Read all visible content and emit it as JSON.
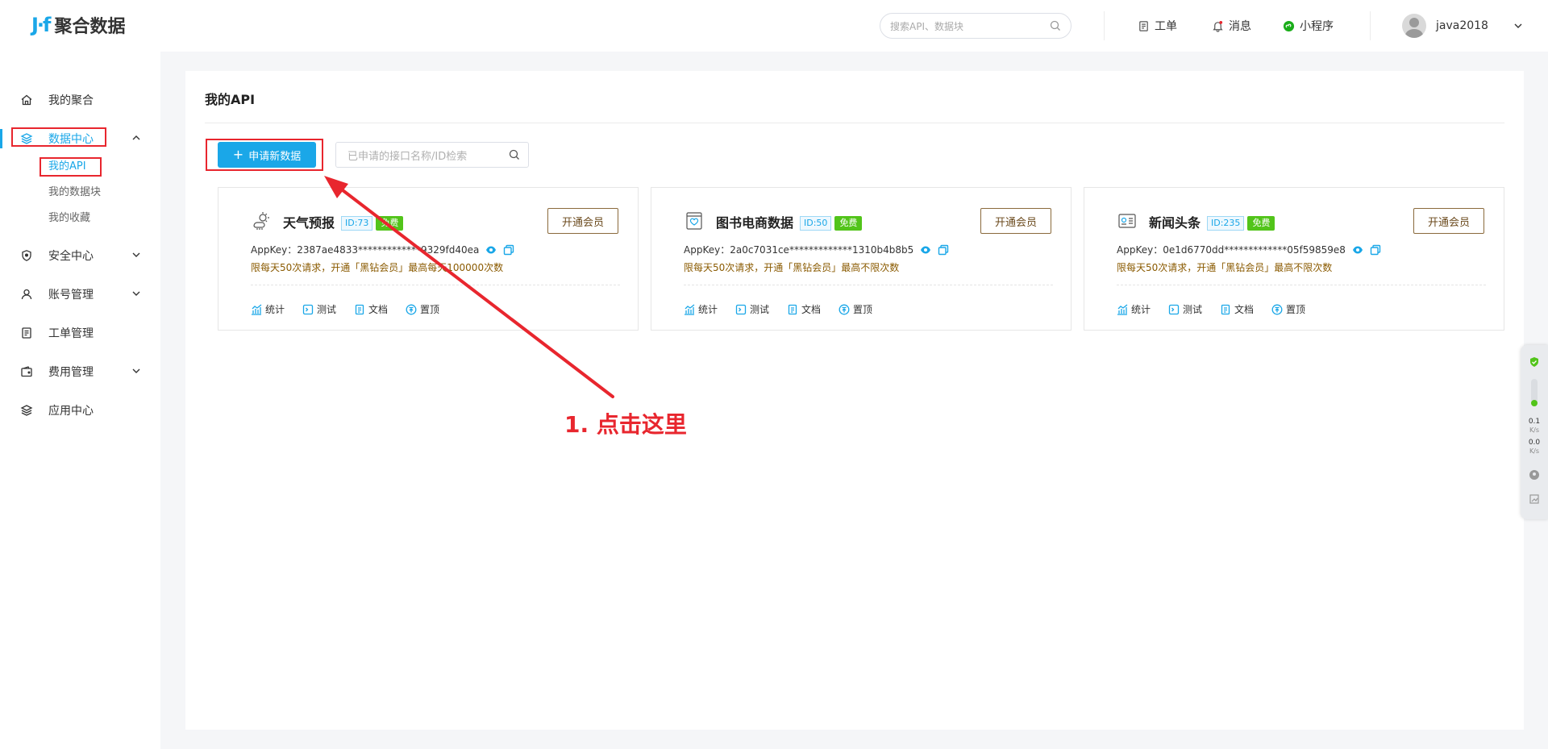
{
  "brand": {
    "mark": "J·f",
    "name": "聚合数据"
  },
  "sidebar": {
    "items": [
      {
        "label": "我的聚合"
      },
      {
        "label": "数据中心"
      },
      {
        "label": "安全中心"
      },
      {
        "label": "账号管理"
      },
      {
        "label": "工单管理"
      },
      {
        "label": "费用管理"
      },
      {
        "label": "应用中心"
      }
    ],
    "sub_items": [
      {
        "label": "我的API"
      },
      {
        "label": "我的数据块"
      },
      {
        "label": "我的收藏"
      }
    ]
  },
  "header": {
    "search_placeholder": "搜索API、数据块",
    "links": [
      {
        "label": "工单"
      },
      {
        "label": "消息"
      },
      {
        "label": "小程序"
      }
    ],
    "username": "java2018"
  },
  "main": {
    "title": "我的API",
    "apply_button": "申请新数据",
    "apply_plus": "+",
    "search_placeholder": "已申请的接口名称/ID检索",
    "cards": [
      {
        "title": "天气预报",
        "id": "ID:73",
        "badge": "免费",
        "member_button": "开通会员",
        "appkey": "AppKey：2387ae4833*************9329fd40ea",
        "limit": "限每天50次请求，开通「黑钻会员」最高每天100000次数",
        "actions": [
          "统计",
          "测试",
          "文档",
          "置顶"
        ]
      },
      {
        "title": "图书电商数据",
        "id": "ID:50",
        "badge": "免费",
        "member_button": "开通会员",
        "appkey": "AppKey：2a0c7031ce*************1310b4b8b5",
        "limit": "限每天50次请求，开通「黑钻会员」最高不限次数",
        "actions": [
          "统计",
          "测试",
          "文档",
          "置顶"
        ]
      },
      {
        "title": "新闻头条",
        "id": "ID:235",
        "badge": "免费",
        "member_button": "开通会员",
        "appkey": "AppKey：0e1d6770dd*************05f59859e8",
        "limit": "限每天50次请求，开通「黑钻会员」最高不限次数",
        "actions": [
          "统计",
          "测试",
          "文档",
          "置顶"
        ]
      }
    ]
  },
  "annotation": {
    "text": "1. 点击这里"
  },
  "widget": {
    "up": "0.1",
    "down": "0.0",
    "unit": "K/s"
  },
  "colors": {
    "accent": "#1aa7e8",
    "annotation": "#e8262e",
    "free_badge": "#52c41a",
    "member_border": "#8a6a3c"
  }
}
